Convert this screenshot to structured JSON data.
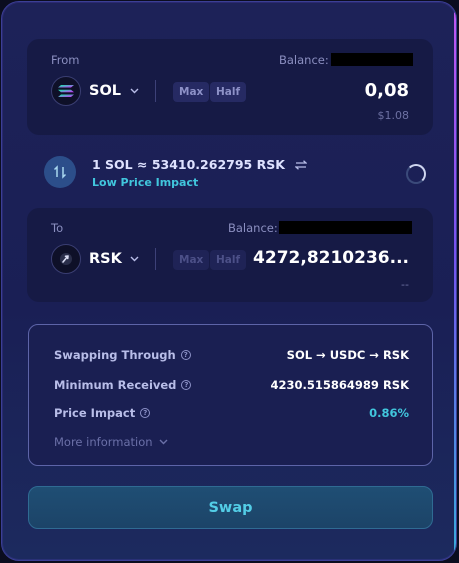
{
  "from": {
    "label": "From",
    "balance_label": "Balance:",
    "token": "SOL",
    "token_icon": "solana-icon",
    "max_label": "Max",
    "half_label": "Half",
    "amount": "0,08",
    "usd_value": "$1.08"
  },
  "rate": {
    "text": "1 SOL ≈ 53410.262795 RSK",
    "price_impact_label": "Low Price Impact"
  },
  "to": {
    "label": "To",
    "balance_label": "Balance:",
    "token": "RSK",
    "token_icon": "rsk-icon",
    "max_label": "Max",
    "half_label": "Half",
    "amount": "4272,8210236...",
    "usd_value": "--"
  },
  "details": {
    "swapping_through_label": "Swapping Through",
    "swapping_through_value": "SOL → USDC → RSK",
    "minimum_received_label": "Minimum Received",
    "minimum_received_value": "4230.515864989 RSK",
    "price_impact_label": "Price Impact",
    "price_impact_value": "0.86%",
    "more_info_label": "More information"
  },
  "swap_button_label": "Swap",
  "colors": {
    "accent_cyan": "#41c6dd",
    "panel_bg": "#161a45",
    "card_bg": "#1d2258"
  }
}
